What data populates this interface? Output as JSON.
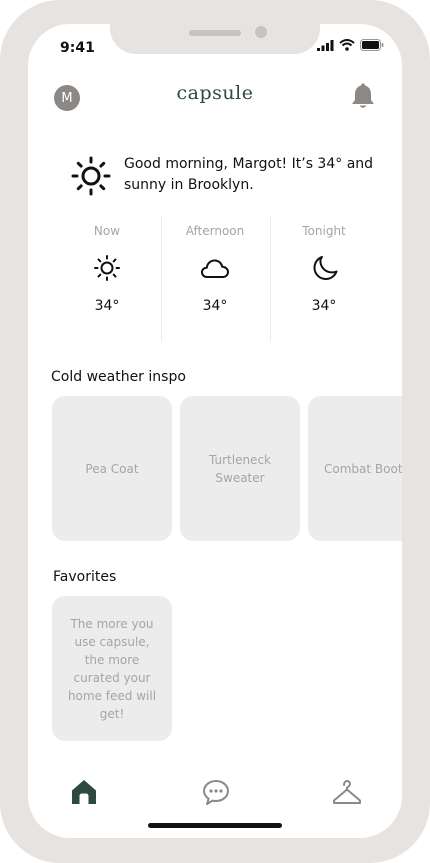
{
  "status_bar": {
    "time": "9:41"
  },
  "header": {
    "avatar_initial": "M",
    "logo": "capsule",
    "icons": [
      "bell-icon"
    ]
  },
  "greeting": {
    "icon": "sun-icon",
    "text": "Good morning, Margot! It’s 34° and sunny in Brooklyn."
  },
  "forecast": [
    {
      "label": "Now",
      "icon": "sun-icon",
      "temp": "34°"
    },
    {
      "label": "Afternoon",
      "icon": "cloud-icon",
      "temp": "34°"
    },
    {
      "label": "Tonight",
      "icon": "moon-icon",
      "temp": "34°"
    }
  ],
  "inspo": {
    "title": "Cold weather inspo",
    "items": [
      "Pea Coat",
      "Turtleneck Sweater",
      "Combat Boots"
    ]
  },
  "favorites": {
    "title": "Favorites",
    "empty_text": "The more you use capsule, the more curated your home feed will get!"
  },
  "nav": {
    "items": [
      "home-icon",
      "chat-icon",
      "hanger-icon"
    ],
    "active_color": "#2e4a40"
  }
}
